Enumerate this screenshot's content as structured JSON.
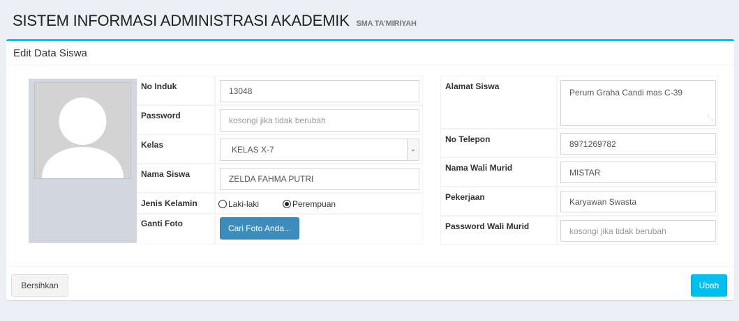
{
  "header": {
    "title": "SISTEM INFORMASI ADMINISTRASI AKADEMIK",
    "subtitle": "SMA TA'MIRIYAH"
  },
  "box": {
    "title": "Edit Data Siswa"
  },
  "form_left": {
    "no_induk": {
      "label": "No Induk",
      "value": "13048"
    },
    "password": {
      "label": "Password",
      "placeholder": "kosongi jika tidak berubah"
    },
    "kelas": {
      "label": "Kelas",
      "value": "KELAS X-7"
    },
    "nama_siswa": {
      "label": "Nama Siswa",
      "value": "ZELDA FAHMA PUTRI"
    },
    "jenis_kelamin": {
      "label": "Jenis Kelamin",
      "option_male": "Laki-laki",
      "option_female": "Perempuan",
      "selected": "Perempuan"
    },
    "ganti_foto": {
      "label": "Ganti Foto",
      "button": "Cari Foto Anda..."
    }
  },
  "form_right": {
    "alamat": {
      "label": "Alamat Siswa",
      "value": "Perum Graha Candi mas C-39"
    },
    "telepon": {
      "label": "No Telepon",
      "value": "8971269782"
    },
    "wali": {
      "label": "Nama Wali Murid",
      "value": "MISTAR"
    },
    "pekerjaan": {
      "label": "Pekerjaan",
      "value": "Karyawan Swasta"
    },
    "password_wali": {
      "label": "Password Wali Murid",
      "placeholder": "kosongi jika tidak berubah"
    }
  },
  "footer": {
    "reset_label": "Bersihkan",
    "submit_label": "Ubah"
  },
  "colors": {
    "accent": "#00c0ef",
    "primary": "#3c8dbc",
    "background": "#ecf0f5"
  },
  "icons": {
    "avatar": "user-silhouette-icon",
    "select": "chevron-down-icon"
  }
}
